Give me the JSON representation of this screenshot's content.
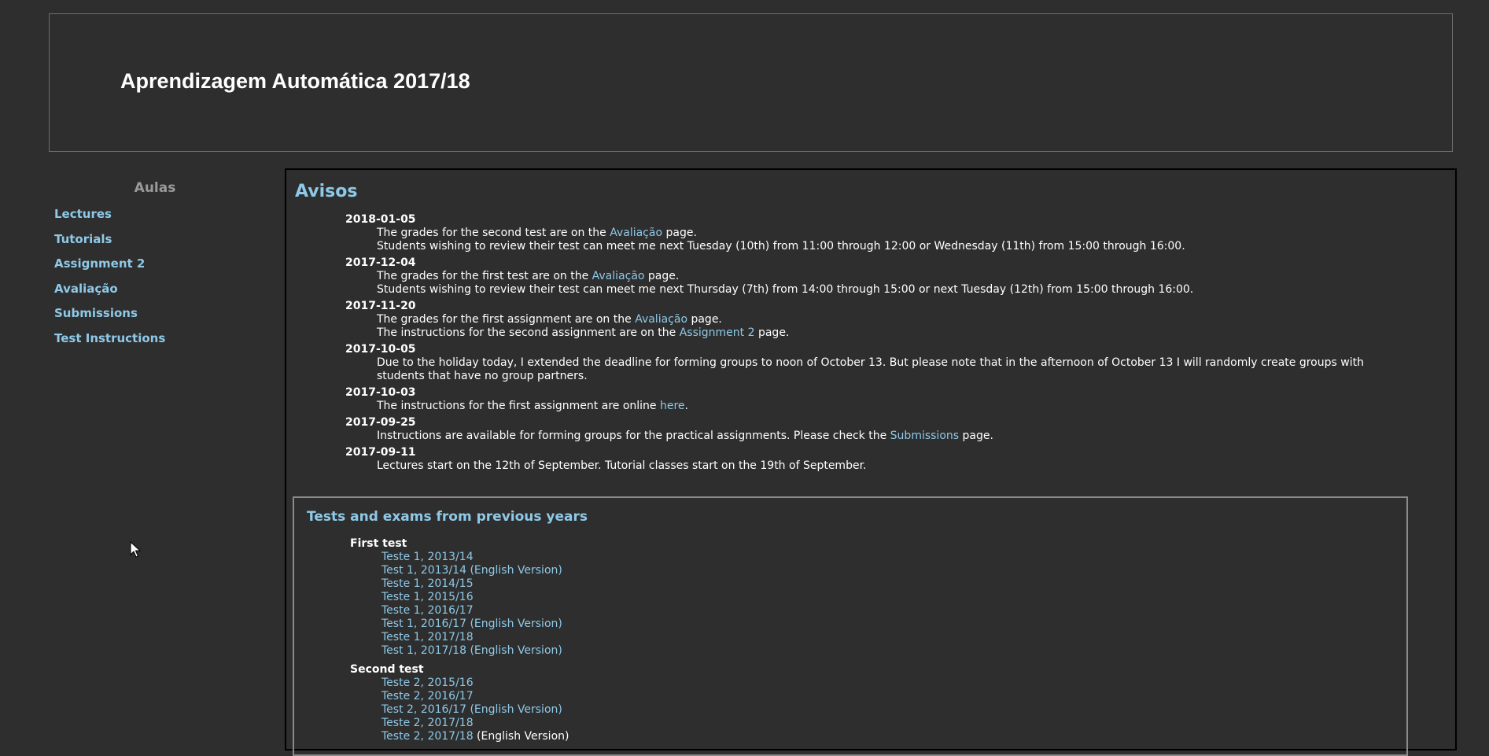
{
  "header": {
    "title": "Aprendizagem Automática 2017/18"
  },
  "sidebar": {
    "heading": "Aulas",
    "items": [
      {
        "label": "Lectures"
      },
      {
        "label": "Tutorials"
      },
      {
        "label": "Assignment 2"
      },
      {
        "label": "Avaliação"
      },
      {
        "label": "Submissions"
      },
      {
        "label": "Test Instructions"
      }
    ]
  },
  "main": {
    "heading": "Avisos",
    "notices": [
      {
        "date": "2018-01-05",
        "lines": [
          {
            "before": "The grades for the second test are on the ",
            "link": "Avaliação",
            "after": " page."
          },
          {
            "before": "Students wishing to review their test can meet me next Tuesday (10th) from 11:00 through 12:00 or Wednesday (11th) from 15:00 through 16:00.",
            "link": "",
            "after": ""
          }
        ]
      },
      {
        "date": "2017-12-04",
        "lines": [
          {
            "before": "The grades for the first test are on the ",
            "link": "Avaliação",
            "after": " page."
          },
          {
            "before": "Students wishing to review their test can meet me next Thursday (7th) from 14:00 through 15:00 or next Tuesday (12th) from 15:00 through 16:00.",
            "link": "",
            "after": ""
          }
        ]
      },
      {
        "date": "2017-11-20",
        "lines": [
          {
            "before": "The grades for the first assignment are on the ",
            "link": "Avaliação",
            "after": " page."
          },
          {
            "before": "The instructions for the second assignment are on the ",
            "link": "Assignment 2",
            "after": " page."
          }
        ]
      },
      {
        "date": "2017-10-05",
        "lines": [
          {
            "before": "Due to the holiday today, I extended the deadline for forming groups to noon of October 13. But please note that in the afternoon of October 13 I will randomly create groups with students that have no group partners.",
            "link": "",
            "after": ""
          }
        ]
      },
      {
        "date": "2017-10-03",
        "lines": [
          {
            "before": "The instructions for the first assignment are online ",
            "link": "here",
            "after": "."
          }
        ]
      },
      {
        "date": "2017-09-25",
        "lines": [
          {
            "before": "Instructions are available for forming groups for the practical assignments. Please check the ",
            "link": "Submissions",
            "after": " page."
          }
        ]
      },
      {
        "date": "2017-09-11",
        "lines": [
          {
            "before": "Lectures start on the 12th of September. Tutorial classes start on the 19th of September.",
            "link": "",
            "after": ""
          }
        ]
      }
    ],
    "tests": {
      "heading": "Tests and exams from previous years",
      "groups": [
        {
          "title": "First test",
          "links": [
            {
              "label": "Teste 1, 2013/14",
              "suffix": ""
            },
            {
              "label": "Test 1, 2013/14 (English Version)",
              "suffix": ""
            },
            {
              "label": "Teste 1, 2014/15",
              "suffix": ""
            },
            {
              "label": "Teste 1, 2015/16",
              "suffix": ""
            },
            {
              "label": "Teste 1, 2016/17",
              "suffix": ""
            },
            {
              "label": "Test 1, 2016/17 (English Version)",
              "suffix": ""
            },
            {
              "label": "Teste 1, 2017/18",
              "suffix": ""
            },
            {
              "label": "Test 1, 2017/18 (English Version)",
              "suffix": ""
            }
          ]
        },
        {
          "title": "Second test",
          "links": [
            {
              "label": "Teste 2, 2015/16",
              "suffix": ""
            },
            {
              "label": "Teste 2, 2016/17",
              "suffix": ""
            },
            {
              "label": "Test 2, 2016/17 (English Version)",
              "suffix": ""
            },
            {
              "label": "Teste 2, 2017/18",
              "suffix": ""
            },
            {
              "label": "Teste 2, 2017/18",
              "suffix": " (English Version)"
            }
          ]
        }
      ]
    }
  },
  "cursor": {
    "icon": "mouse-pointer-icon"
  }
}
